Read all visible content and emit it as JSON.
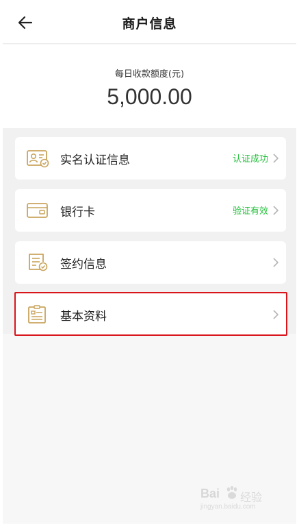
{
  "header": {
    "title": "商户信息",
    "back_icon": "arrow-left-icon"
  },
  "quota": {
    "label": "每日收款额度(元)",
    "value": "5,000.00"
  },
  "menu": {
    "items": [
      {
        "label": "实名认证信息",
        "status": "认证成功",
        "icon": "id-card-check-icon"
      },
      {
        "label": "银行卡",
        "status": "验证有效",
        "icon": "bank-card-icon"
      },
      {
        "label": "签约信息",
        "status": "",
        "icon": "contract-check-icon"
      },
      {
        "label": "基本资料",
        "status": "",
        "icon": "clipboard-icon"
      }
    ],
    "highlighted_item": "基本资料"
  },
  "watermark": {
    "brand": "Bai",
    "cn": "经验",
    "url": "jingyan.baidu.com"
  },
  "colors": {
    "accent_icon": "#c9a45c",
    "status_green": "#22c03a",
    "highlight_border": "#d9141b"
  }
}
